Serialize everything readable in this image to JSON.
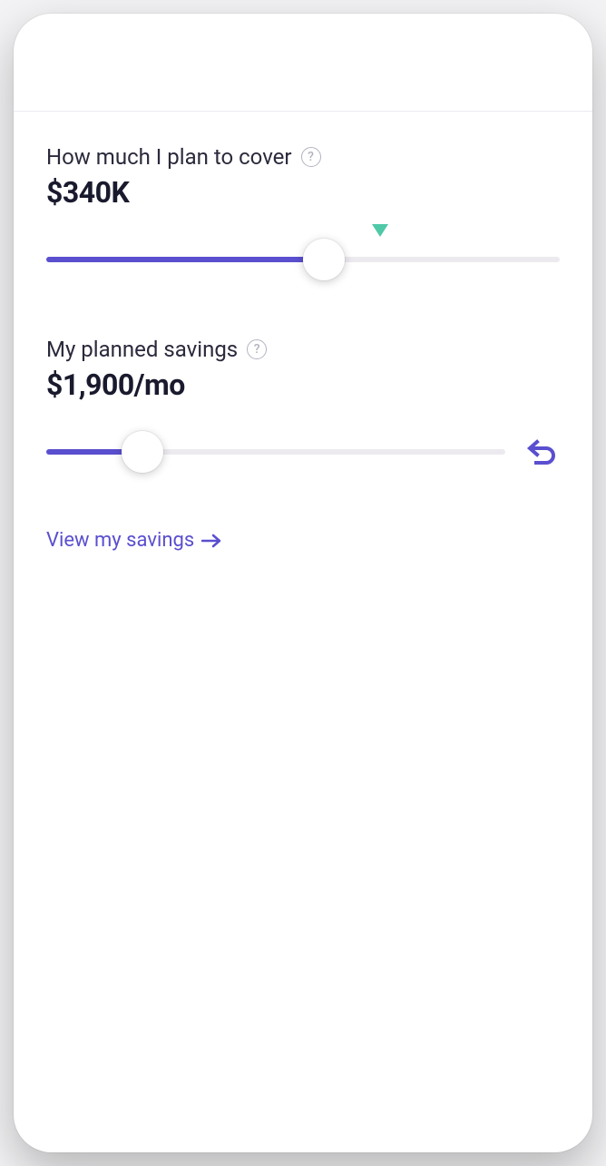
{
  "coverage": {
    "label": "How much I plan to cover",
    "value": "$340K",
    "slider_percent": 54,
    "marker_percent": 65
  },
  "savings": {
    "label": "My planned savings",
    "value": "$1,900/mo",
    "slider_percent": 21
  },
  "link": {
    "text": "View my savings"
  },
  "colors": {
    "accent": "#5a4fcf",
    "marker": "#4fc9a8"
  }
}
